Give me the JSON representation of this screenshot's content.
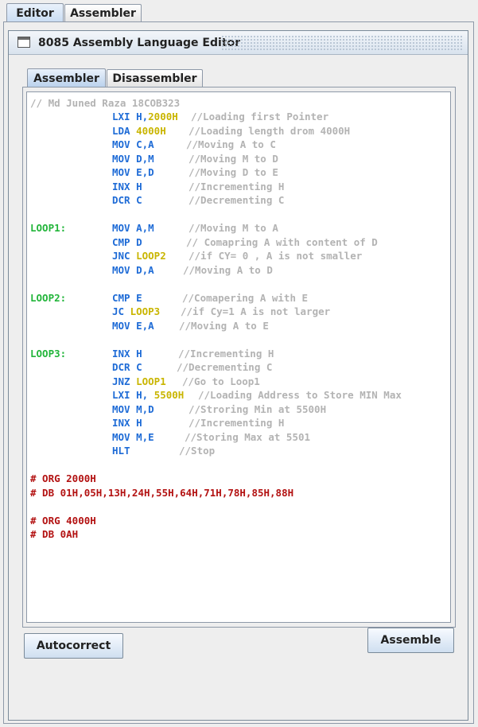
{
  "top_tabs": [
    {
      "label": "Editor"
    },
    {
      "label": "Assembler"
    }
  ],
  "window": {
    "title": "8085 Assembly Language Editor"
  },
  "inner_tabs": [
    {
      "label": "Assembler"
    },
    {
      "label": "Disassembler"
    }
  ],
  "code": {
    "header_comment": "// Md Juned Raza 18COB323",
    "lines": [
      {
        "instr": "LXI H,",
        "num": "2000H",
        "comment": "//Loading first Pointer"
      },
      {
        "instr": "LDA ",
        "num": "4000H",
        "comment": "//Loading length drom 4000H"
      },
      {
        "instr": "MOV C,A",
        "comment": "//Moving A to C"
      },
      {
        "instr": "MOV D,M",
        "comment": "//Moving M to D"
      },
      {
        "instr": "MOV E,D",
        "comment": "//Moving D to E"
      },
      {
        "instr": "INX H",
        "comment": "//Incrementing H"
      },
      {
        "instr": "DCR C",
        "comment": "//Decrementing C"
      },
      {
        "label": "LOOP1:",
        "instr": "MOV A,M",
        "comment": "//Moving M to A"
      },
      {
        "instr": "CMP D",
        "comment": "// Comapring A with content of D"
      },
      {
        "instr": "JNC ",
        "num": "LOOP2",
        "comment": "//if CY= 0 , A is not smaller"
      },
      {
        "instr": "MOV D,A",
        "comment": "//Moving A to D"
      },
      {
        "label": "LOOP2:",
        "instr": "CMP E",
        "comment": "//Comapering A with E"
      },
      {
        "instr": "JC ",
        "num": "LOOP3",
        "comment": "//if Cy=1 A is not larger"
      },
      {
        "instr": "MOV E,A",
        "comment": "//Moving A to E"
      },
      {
        "label": "LOOP3:",
        "instr": "INX H",
        "comment": "//Incrementing H"
      },
      {
        "instr": "DCR C",
        "comment": "//Decrementing C"
      },
      {
        "instr": "JNZ ",
        "num": "LOOP1",
        "comment": "//Go to Loop1"
      },
      {
        "instr": "LXI H, ",
        "num": "5500H",
        "comment": "//Loading Address to Store MIN Max"
      },
      {
        "instr": "MOV M,D",
        "comment": "//Stroring Min at 5500H"
      },
      {
        "instr": "INX H",
        "comment": "//Incrementing H"
      },
      {
        "instr": "MOV M,E",
        "comment": "//Storing Max at 5501"
      },
      {
        "instr": "HLT",
        "comment": "//Stop"
      }
    ],
    "directives": [
      {
        "text": "# ORG 2000H"
      },
      {
        "text": "# DB 01H,05H,13H,24H,55H,64H,71H,78H,85H,88H"
      },
      {
        "text": "# ORG 4000H"
      },
      {
        "text": "# DB 0AH"
      }
    ]
  },
  "buttons": {
    "autocorrect": "Autocorrect",
    "assemble": "Assemble"
  },
  "colors": {
    "comment": "#b3b3b3",
    "instruction": "#1e6bd6",
    "number": "#c9b500",
    "label": "#22b53a",
    "directive": "#b31212"
  }
}
